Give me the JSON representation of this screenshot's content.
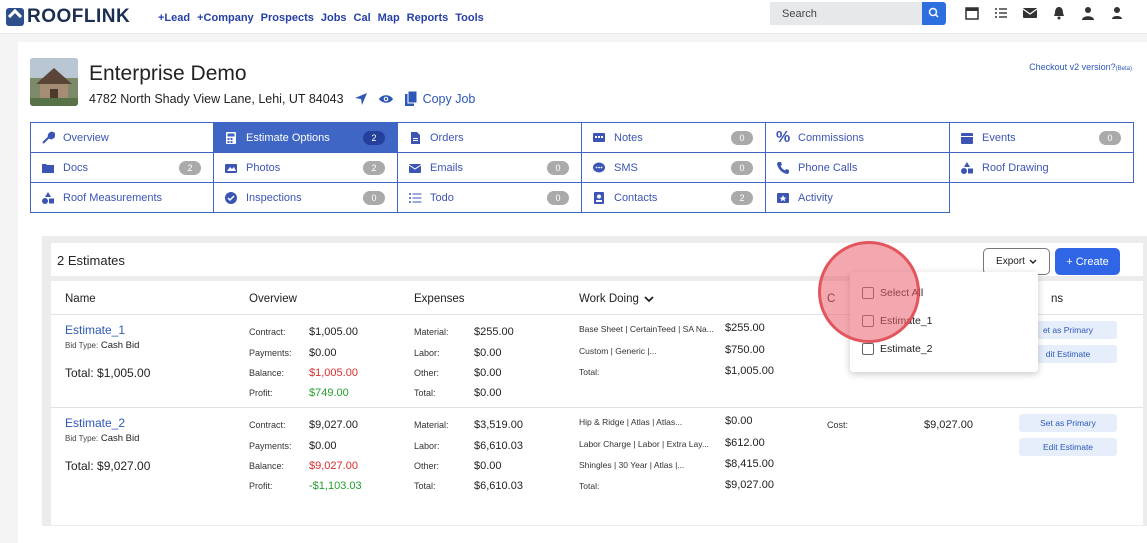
{
  "nav": {
    "logo_text": "ROOFLINK",
    "links": [
      "+Lead",
      "+Company",
      "Prospects",
      "Jobs",
      "Cal",
      "Map",
      "Reports",
      "Tools"
    ],
    "search_placeholder": "Search",
    "icons": [
      "calendar-icon",
      "list-icon",
      "mail-icon",
      "bell-icon",
      "users-icon",
      "user-icon"
    ]
  },
  "job": {
    "title": "Enterprise Demo",
    "address": "4782 North Shady View Lane, Lehi, UT 84043",
    "copy_job": "Copy Job",
    "checkout_link": "Checkout v2 version?",
    "checkout_beta": "(Beta)"
  },
  "tabs": [
    {
      "label": "Overview",
      "icon": "wrench-icon",
      "badge": null
    },
    {
      "label": "Estimate Options",
      "icon": "calculator-icon",
      "badge": "2",
      "active": true
    },
    {
      "label": "Orders",
      "icon": "document-icon",
      "badge": null
    },
    {
      "label": "Notes",
      "icon": "note-icon",
      "badge": "0"
    },
    {
      "label": "Commissions",
      "icon": "percent-icon",
      "badge": null
    },
    {
      "label": "Events",
      "icon": "calendar-icon",
      "badge": "0"
    },
    {
      "label": "Docs",
      "icon": "folder-icon",
      "badge": "2"
    },
    {
      "label": "Photos",
      "icon": "photos-icon",
      "badge": "2"
    },
    {
      "label": "Emails",
      "icon": "envelope-icon",
      "badge": "0"
    },
    {
      "label": "SMS",
      "icon": "sms-icon",
      "badge": "0"
    },
    {
      "label": "Phone Calls",
      "icon": "phone-icon",
      "badge": null
    },
    {
      "label": "Roof Drawing",
      "icon": "shapes-icon",
      "badge": null
    },
    {
      "label": "Roof Measurements",
      "icon": "shapes-icon",
      "badge": null
    },
    {
      "label": "Inspections",
      "icon": "check-circle-icon",
      "badge": "0"
    },
    {
      "label": "Todo",
      "icon": "list-icon",
      "badge": "0"
    },
    {
      "label": "Contacts",
      "icon": "contact-icon",
      "badge": "2"
    },
    {
      "label": "Activity",
      "icon": "activity-icon",
      "badge": null
    }
  ],
  "estimates": {
    "count_label": "2 Estimates",
    "export_label": "Export",
    "create_label": "+ Create",
    "columns": {
      "name": "Name",
      "overview": "Overview",
      "expenses": "Expenses",
      "work_doing": "Work Doing",
      "cost_partial": "C",
      "actions_partial": "ns"
    },
    "rows": [
      {
        "name": "Estimate_1",
        "bid_type_label": "Bid Type:",
        "bid_type": "Cash Bid",
        "total": "Total:  $1,005.00",
        "overview": [
          {
            "label": "Contract:",
            "value": "$1,005.00",
            "tone": "normal"
          },
          {
            "label": "Payments:",
            "value": "$0.00",
            "tone": "normal"
          },
          {
            "label": "Balance:",
            "value": "$1,005.00",
            "tone": "red"
          },
          {
            "label": "Profit:",
            "value": "$749.00",
            "tone": "green"
          }
        ],
        "expenses": [
          {
            "label": "Material:",
            "value": "$255.00"
          },
          {
            "label": "Labor:",
            "value": "$0.00"
          },
          {
            "label": "Other:",
            "value": "$0.00"
          },
          {
            "label": "Total:",
            "value": "$0.00"
          }
        ],
        "work_doing": [
          {
            "label": "Base Sheet | CertainTeed | SA Na...",
            "value": "$255.00"
          },
          {
            "label": "Custom | Generic |...",
            "value": "$750.00"
          },
          {
            "label": "Total:",
            "value": "$1,005.00"
          }
        ],
        "cost_label": "",
        "cost_value": "",
        "primary_button": "et as Primary",
        "edit_button": "dit Estimate"
      },
      {
        "name": "Estimate_2",
        "bid_type_label": "Bid Type:",
        "bid_type": "Cash Bid",
        "total": "Total:  $9,027.00",
        "overview": [
          {
            "label": "Contract:",
            "value": "$9,027.00",
            "tone": "normal"
          },
          {
            "label": "Payments:",
            "value": "$0.00",
            "tone": "normal"
          },
          {
            "label": "Balance:",
            "value": "$9,027.00",
            "tone": "red"
          },
          {
            "label": "Profit:",
            "value": "-$1,103.03",
            "tone": "green"
          }
        ],
        "expenses": [
          {
            "label": "Material:",
            "value": "$3,519.00"
          },
          {
            "label": "Labor:",
            "value": "$6,610.03"
          },
          {
            "label": "Other:",
            "value": "$0.00"
          },
          {
            "label": "Total:",
            "value": "$6,610.03"
          }
        ],
        "work_doing": [
          {
            "label": "Hip & Ridge | Atlas | Atlas...",
            "value": "$0.00"
          },
          {
            "label": "Labor Charge | Labor | Extra Lay...",
            "value": "$612.00"
          },
          {
            "label": "Shingles | 30 Year | Atlas |...",
            "value": "$8,415.00"
          },
          {
            "label": "Total:",
            "value": "$9,027.00"
          }
        ],
        "cost_label": "Cost:",
        "cost_value": "$9,027.00",
        "primary_button": "Set as Primary",
        "edit_button": "Edit Estimate"
      }
    ]
  },
  "export_dropdown": {
    "items": [
      "Select All",
      "Estimate_1",
      "Estimate_2"
    ]
  },
  "colors": {
    "brand": "#2d4f8c",
    "accent": "#3f66c4",
    "primary_button": "#3066e6",
    "negative": "#d82d2d",
    "positive": "#22a02e",
    "click_indicator": "#e7606c"
  }
}
